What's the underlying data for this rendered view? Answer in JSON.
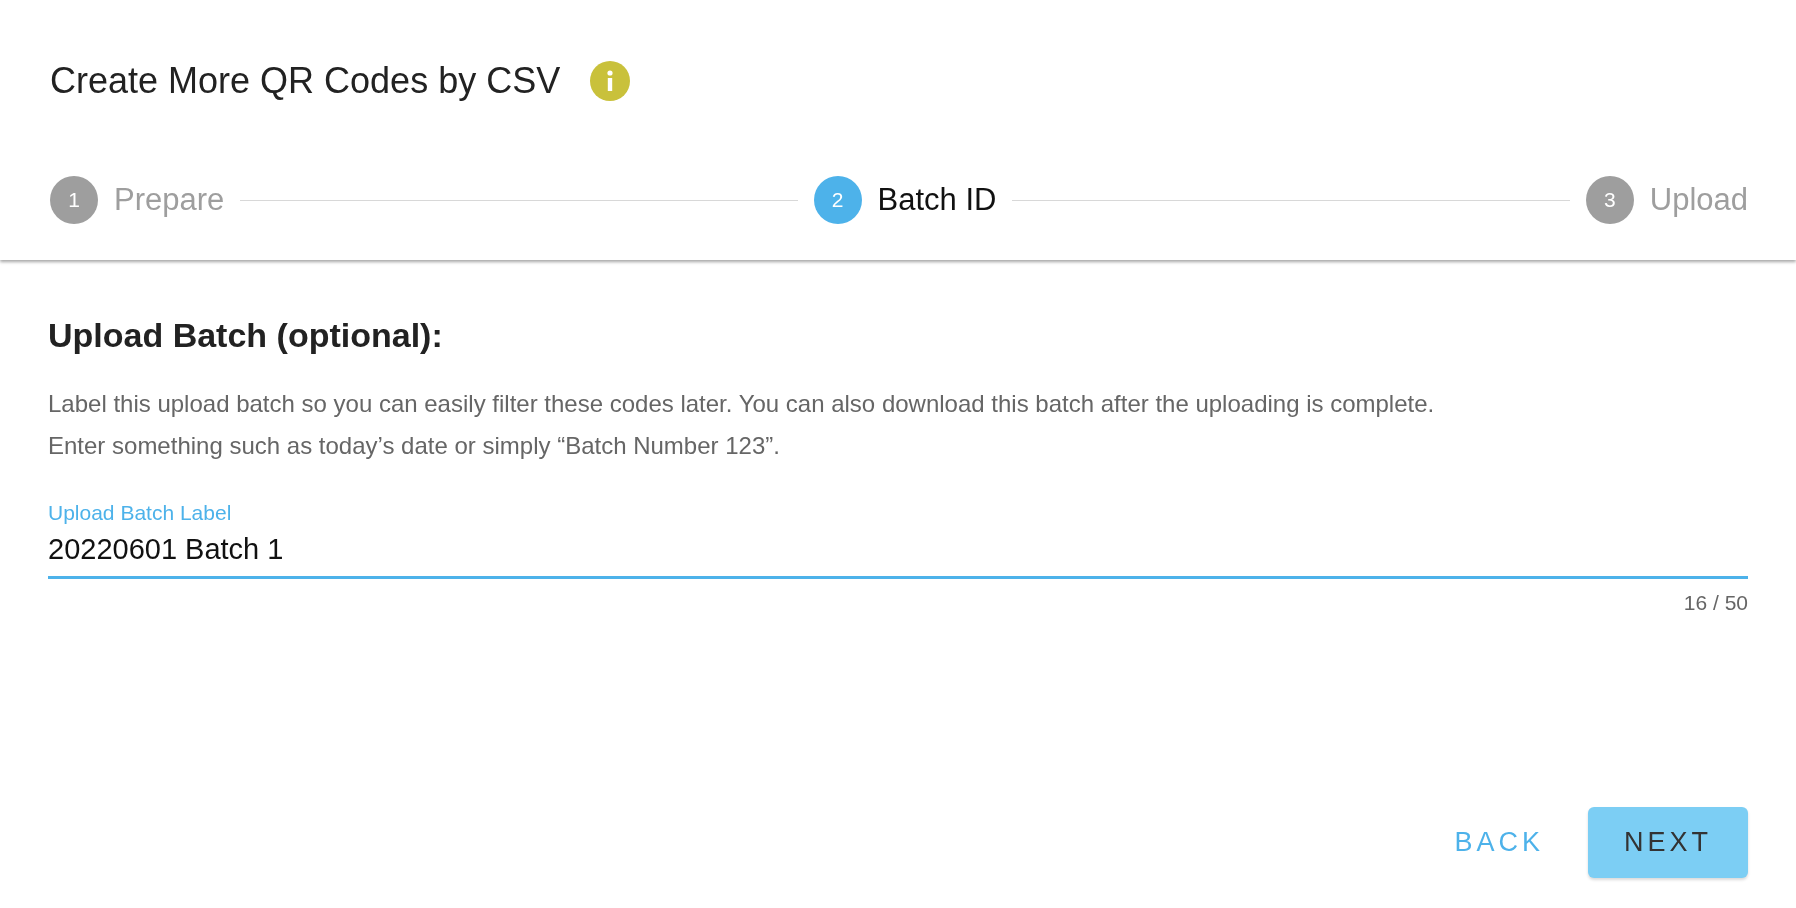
{
  "dialog": {
    "title": "Create More QR Codes by CSV"
  },
  "steps": [
    {
      "number": "1",
      "label": "Prepare",
      "selected": false
    },
    {
      "number": "2",
      "label": "Batch ID",
      "selected": true
    },
    {
      "number": "3",
      "label": "Upload",
      "selected": false
    }
  ],
  "section": {
    "heading": "Upload Batch (optional):",
    "description": "Label this upload batch so you can easily filter these codes later. You can also download this batch after the uploading is complete.\nEnter something such as today’s date or simply “Batch Number 123”."
  },
  "field": {
    "label": "Upload Batch Label",
    "value": "20220601 Batch 1",
    "counter": "16 / 50",
    "focused": true
  },
  "buttons": [
    {
      "kind": "text",
      "label": "BACK"
    },
    {
      "kind": "filled",
      "label": "NEXT"
    }
  ]
}
